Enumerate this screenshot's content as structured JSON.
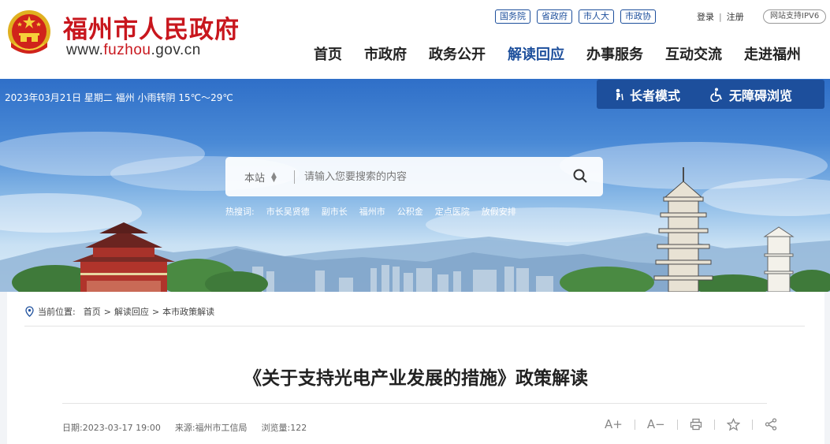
{
  "header": {
    "site_name": "福州市人民政府",
    "url_prefix": "www.",
    "url_mid": "fuzhou",
    "url_suffix": ".gov.cn",
    "top_links": [
      "国务院",
      "省政府",
      "市人大",
      "市政协"
    ],
    "login": "登录",
    "auth_sep": "|",
    "register": "注册",
    "ipv6": "网站支持IPV6",
    "nav": [
      "首页",
      "市政府",
      "政务公开",
      "解读回应",
      "办事服务",
      "互动交流",
      "走进福州"
    ],
    "active_nav": "解读回应"
  },
  "banner": {
    "date_weather": "2023年03月21日 星期二 福州 小雨转阴 15℃～29℃",
    "elder_mode": "长者模式",
    "accessible": "无障碍浏览",
    "search": {
      "scope": "本站",
      "placeholder": "请输入您要搜索的内容"
    },
    "hot_label": "热搜词:",
    "hot_words": [
      "市长吴贤德",
      "副市长",
      "福州市",
      "公积金",
      "定点医院",
      "放假安排"
    ]
  },
  "breadcrumb": {
    "label": "当前位置:",
    "items": [
      "首页",
      "解读回应",
      "本市政策解读"
    ],
    "sep": ">"
  },
  "article": {
    "title": "《关于支持光电产业发展的措施》政策解读",
    "date_label": "日期:",
    "date": "2023-03-17 19:00",
    "source_label": "来源:",
    "source": "福州市工信局",
    "views_label": "浏览量:",
    "views": "122"
  },
  "tools": {
    "font_up": "A+",
    "font_down": "A−"
  },
  "colors": {
    "brand_red": "#c8161d",
    "brand_blue": "#1d4f9c"
  }
}
